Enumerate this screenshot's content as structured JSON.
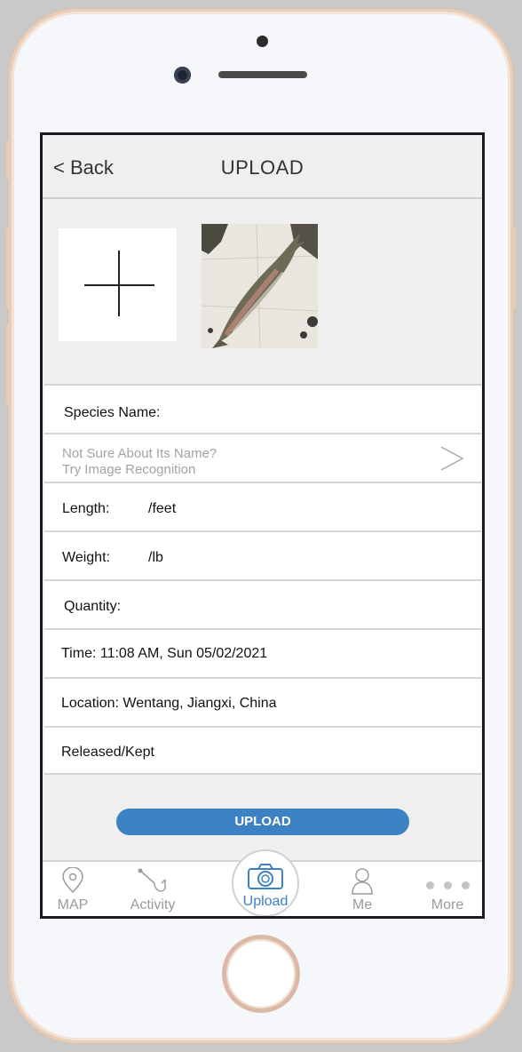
{
  "header": {
    "back_label": "< Back",
    "title": "UPLOAD"
  },
  "form": {
    "species_label": "Species Name:",
    "recognition_hint_line1": "Not Sure About Its Name?",
    "recognition_hint_line2": "Try Image Recognition",
    "length_label": "Length:",
    "length_unit": "/feet",
    "weight_label": "Weight:",
    "weight_unit": "/lb",
    "quantity_label": "Quantity:",
    "time_text": "Time: 11:08 AM, Sun 05/02/2021",
    "location_text": "Location: Wentang, Jiangxi, China",
    "released_kept_label": "Released/Kept"
  },
  "upload_button_label": "UPLOAD",
  "tabbar": {
    "map": "MAP",
    "activity": "Activity",
    "upload": "Upload",
    "me": "Me",
    "more": "More"
  },
  "icons": [
    "plus-icon",
    "fish-photo",
    "chevron-right-icon",
    "map-pin-icon",
    "fishing-hook-icon",
    "camera-icon",
    "user-icon",
    "more-dots-icon"
  ],
  "colors": {
    "accent": "#3b81c3",
    "screen_bg": "#efefef",
    "phone_frame": "#e8cdb8"
  }
}
